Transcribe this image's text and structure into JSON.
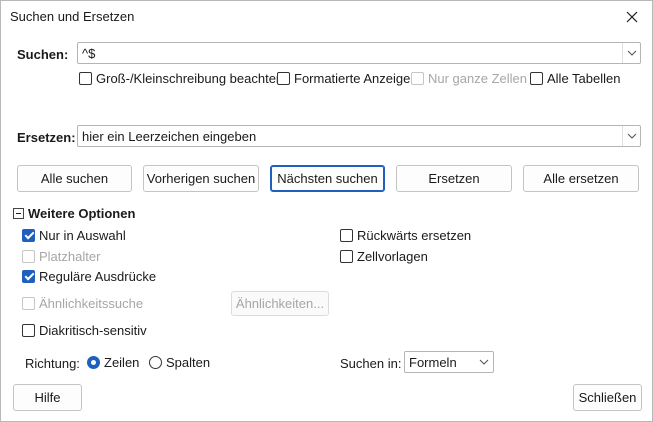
{
  "window": {
    "title": "Suchen und Ersetzen"
  },
  "search": {
    "label": "Suchen:",
    "value": "^$"
  },
  "search_options": {
    "match_case": "Groß-/Kleinschreibung beachten",
    "formatted_display": "Formatierte Anzeige",
    "entire_cells": "Nur ganze Zellen",
    "all_sheets": "Alle Tabellen"
  },
  "replace": {
    "label": "Ersetzen:",
    "value": "hier ein Leerzeichen eingeben"
  },
  "buttons": {
    "find_all": "Alle suchen",
    "find_previous": "Vorherigen suchen",
    "find_next": "Nächsten suchen",
    "replace": "Ersetzen",
    "replace_all": "Alle ersetzen",
    "similarity_settings": "Ähnlichkeiten...",
    "help": "Hilfe",
    "close": "Schließen"
  },
  "other_options": {
    "header": "Weitere Optionen",
    "current_selection_only": "Nur in Auswahl",
    "wildcards": "Platzhalter",
    "regular_expressions": "Reguläre Ausdrücke",
    "similarity_search": "Ähnlichkeitssuche",
    "diacritics_sensitive": "Diakritisch-sensitiv",
    "replace_backwards": "Rückwärts ersetzen",
    "cell_styles": "Zellvorlagen"
  },
  "direction": {
    "label": "Richtung:",
    "rows": "Zeilen",
    "columns": "Spalten",
    "selected": "rows"
  },
  "search_in": {
    "label": "Suchen in:",
    "value": "Formeln"
  },
  "colors": {
    "accent": "#1f5fbf",
    "disabled_text": "#a6a6a6"
  }
}
